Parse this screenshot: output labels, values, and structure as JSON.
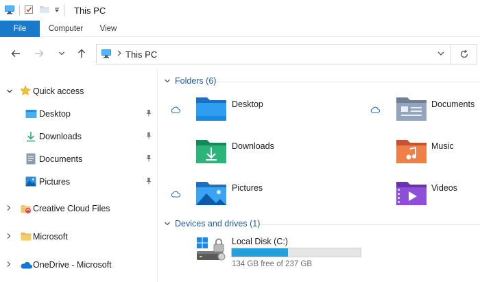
{
  "window": {
    "title": "This PC"
  },
  "ribbon": {
    "tabs": [
      "File",
      "Computer",
      "View"
    ]
  },
  "address": {
    "path": "This PC"
  },
  "sidebar": {
    "quick_access": "Quick access",
    "items": [
      {
        "label": "Desktop",
        "icon": "desktop-folder-icon",
        "pinned": true
      },
      {
        "label": "Downloads",
        "icon": "downloads-icon",
        "pinned": true
      },
      {
        "label": "Documents",
        "icon": "documents-icon",
        "pinned": true
      },
      {
        "label": "Pictures",
        "icon": "pictures-icon",
        "pinned": true
      }
    ],
    "roots": [
      {
        "label": "Creative Cloud Files",
        "icon": "creative-cloud-icon"
      },
      {
        "label": "Microsoft",
        "icon": "folder-icon"
      },
      {
        "label": "OneDrive - Microsoft",
        "icon": "onedrive-icon"
      }
    ]
  },
  "content": {
    "folders_header": "Folders (6)",
    "folders": [
      {
        "name": "Desktop",
        "cloud": true
      },
      {
        "name": "Documents",
        "cloud": true
      },
      {
        "name": "Downloads",
        "cloud": false
      },
      {
        "name": "Music",
        "cloud": false
      },
      {
        "name": "Pictures",
        "cloud": true
      },
      {
        "name": "Videos",
        "cloud": false
      }
    ],
    "devices_header": "Devices and drives (1)",
    "drive": {
      "name": "Local Disk (C:)",
      "free_text": "134 GB free of 237 GB",
      "used_fraction": 0.435
    }
  },
  "colors": {
    "accent": "#1979ca",
    "drive_fill": "#26a0da",
    "group_header": "#1e5aa0"
  }
}
